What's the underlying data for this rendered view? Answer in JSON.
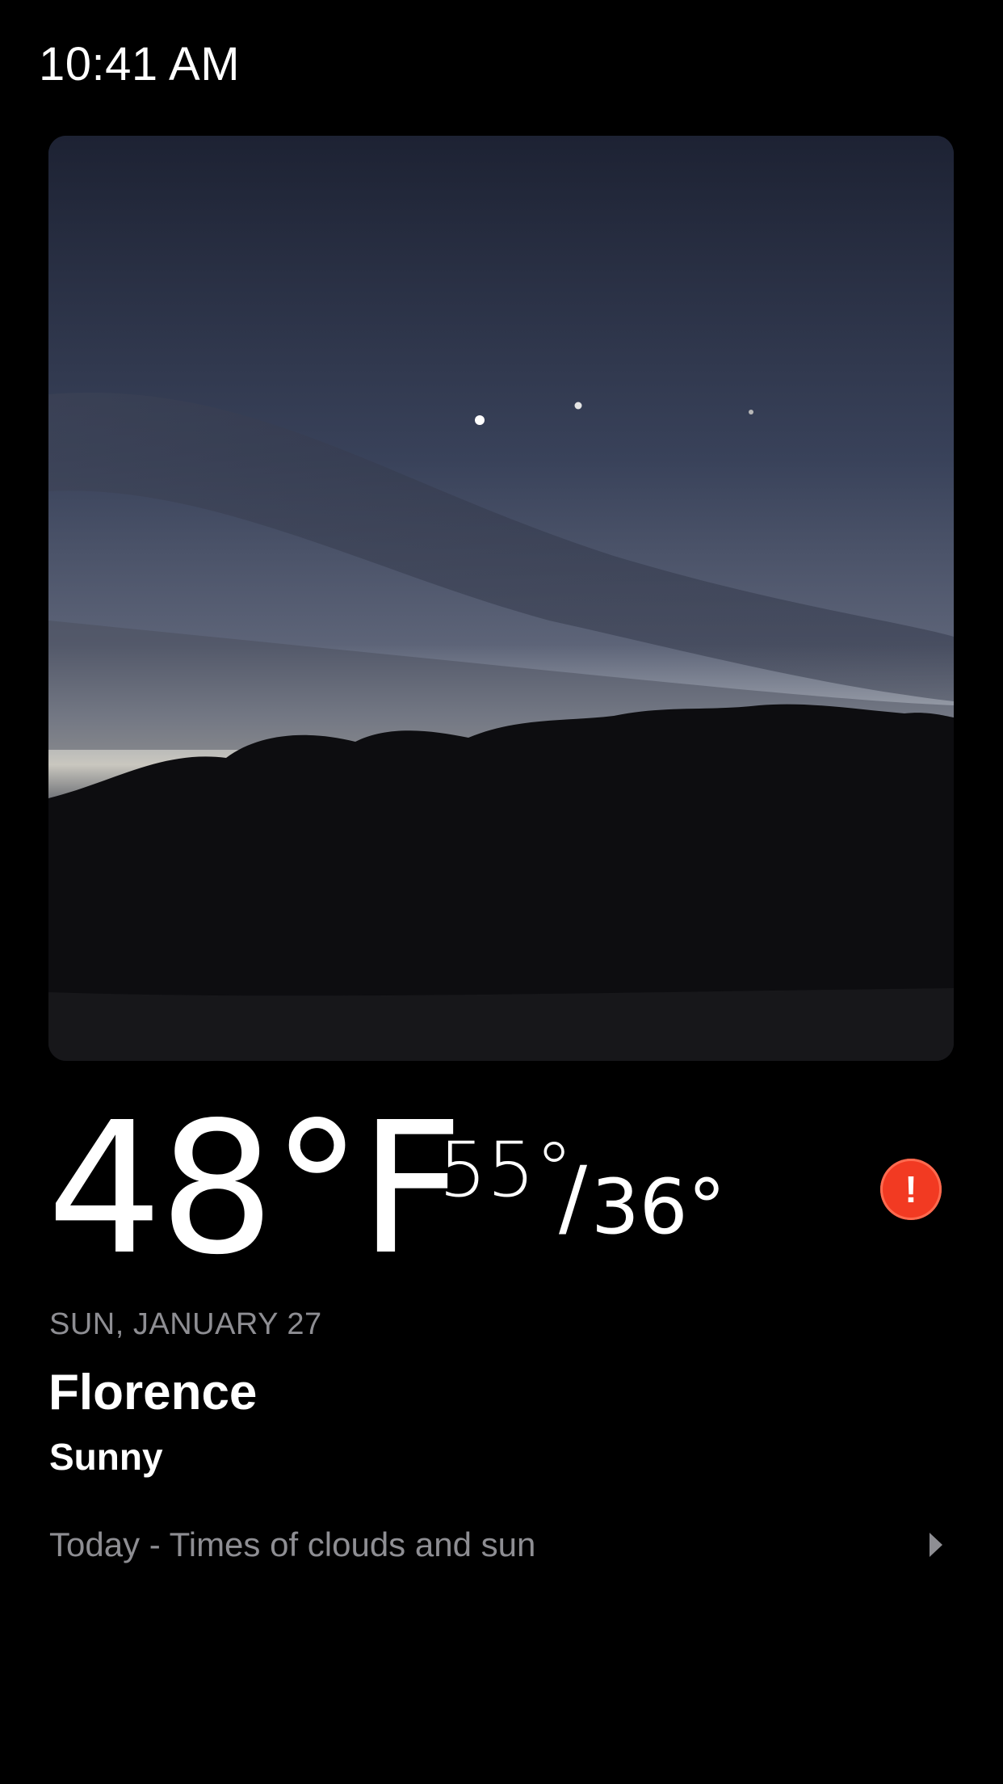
{
  "status_bar": {
    "time": "10:41 AM"
  },
  "weather": {
    "current_temp": "48°F",
    "high": "55°",
    "slash": "/",
    "low": "36°",
    "date": "SUN, JANUARY 27",
    "city": "Florence",
    "condition": "Sunny",
    "forecast_summary": "Today - Times of clouds and sun"
  },
  "alert": {
    "icon": "exclamation-icon",
    "symbol": "!",
    "color": "#f23a22"
  },
  "photo": {
    "description_icon": "sky-photo"
  },
  "colors": {
    "background": "#000000",
    "secondary_text": "#8e8e93",
    "primary_text": "#ffffff"
  }
}
